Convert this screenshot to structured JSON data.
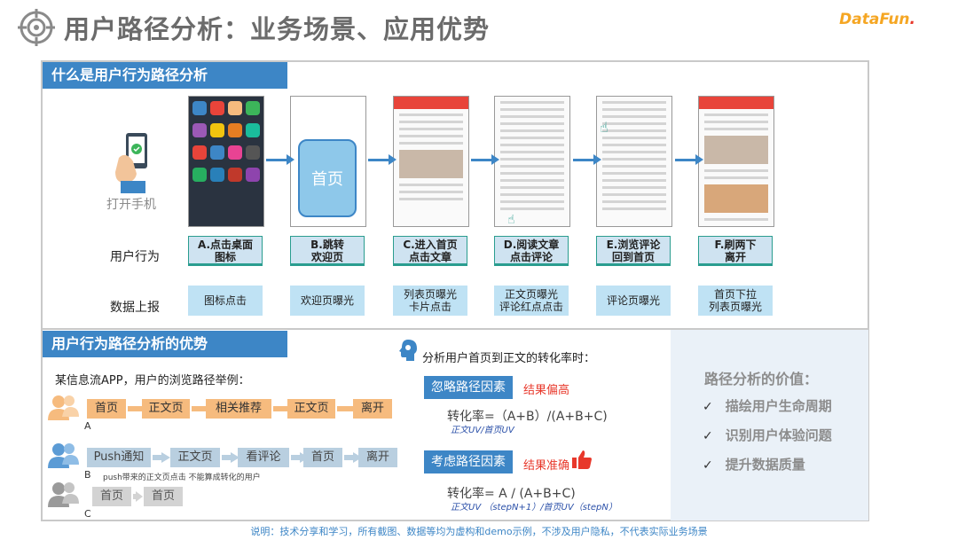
{
  "header": {
    "title": "用户路径分析：业务场景、应用优势",
    "logo_main": "DataFun",
    "logo_dot": "."
  },
  "section1": {
    "title": "什么是用户行为路径分析",
    "open_phone_label": "打开手机",
    "home_page_label": "首页",
    "row_behavior_label": "用户行为",
    "row_report_label": "数据上报",
    "steps": [
      {
        "line1": "A.点击桌面",
        "line2": "图标"
      },
      {
        "line1": "B.跳转",
        "line2": "欢迎页"
      },
      {
        "line1": "C.进入首页",
        "line2": "点击文章"
      },
      {
        "line1": "D.阅读文章",
        "line2": "点击评论"
      },
      {
        "line1": "E.浏览评论",
        "line2": "回到首页"
      },
      {
        "line1": "F.刷两下",
        "line2": "离开"
      }
    ],
    "reports": [
      {
        "line1": "图标点击",
        "line2": ""
      },
      {
        "line1": "欢迎页曝光",
        "line2": ""
      },
      {
        "line1": "列表页曝光",
        "line2": "卡片点击"
      },
      {
        "line1": "正文页曝光",
        "line2": "评论红点点击"
      },
      {
        "line1": "评论页曝光",
        "line2": ""
      },
      {
        "line1": "首页下拉",
        "line2": "列表页曝光"
      }
    ]
  },
  "section2": {
    "title": "用户行为路径分析的优势",
    "example_intro": "某信息流APP，用户的浏览路径举例：",
    "path_a": {
      "label": "A",
      "nodes": [
        "首页",
        "正文页",
        "相关推荐",
        "正文页",
        "离开"
      ]
    },
    "path_b": {
      "label": "B",
      "nodes": [
        "Push通知",
        "正文页",
        "看评论",
        "首页",
        "离开"
      ],
      "note": "push带来的正文页点击 不能算成转化的用户"
    },
    "path_c": {
      "label": "C",
      "nodes": [
        "首页",
        "首页"
      ]
    },
    "analysis_title": "分析用户首页到正文的转化率时：",
    "ignore_tag": "忽略路径因素",
    "ignore_result": "结果偏高",
    "formula1": "转化率=（A+B）/(A+B+C)",
    "formula1_sub": "正文UV/首页UV",
    "consider_tag": "考虑路径因素",
    "consider_result": "结果准确",
    "formula2": "转化率= A / (A+B+C)",
    "formula2_sub": "正文UV （stepN+1）/首页UV（stepN）"
  },
  "value_panel": {
    "title": "路径分析的价值：",
    "items": [
      "描绘用户生命周期",
      "识别用户体验问题",
      "提升数据质量"
    ]
  },
  "footer_note": "说明：技术分享和学习，所有截图、数据等均为虚构和demo示例，不涉及用户隐私，不代表实际业务场景",
  "colors": {
    "accent_blue": "#3d86c6",
    "orange_node": "#f6bb7e",
    "red": "#e8382b",
    "teal_border": "#2a9d8f"
  }
}
